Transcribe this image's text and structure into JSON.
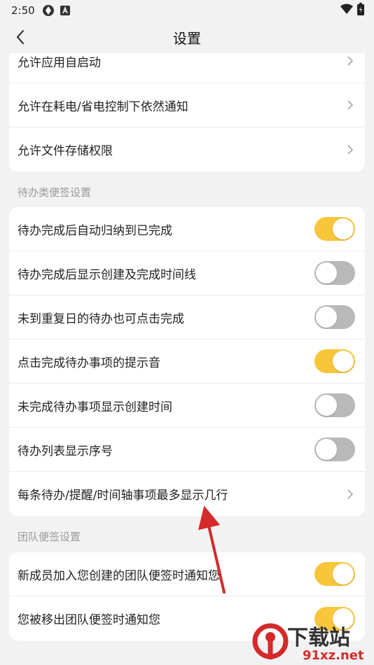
{
  "status_bar": {
    "time": "2:50"
  },
  "header": {
    "title": "设置"
  },
  "permissions": [
    {
      "label": "允许应用自启动"
    },
    {
      "label": "允许在耗电/省电控制下依然通知"
    },
    {
      "label": "允许文件存储权限"
    }
  ],
  "todo_section": {
    "title": "待办类便签设置",
    "items": [
      {
        "label": "待办完成后自动归纳到已完成",
        "type": "toggle",
        "on": true
      },
      {
        "label": "待办完成后显示创建及完成时间线",
        "type": "toggle",
        "on": false
      },
      {
        "label": "未到重复日的待办也可点击完成",
        "type": "toggle",
        "on": false
      },
      {
        "label": "点击完成待办事项的提示音",
        "type": "toggle",
        "on": true
      },
      {
        "label": "未完成待办事项显示创建时间",
        "type": "toggle",
        "on": false
      },
      {
        "label": "待办列表显示序号",
        "type": "toggle",
        "on": false
      },
      {
        "label": "每条待办/提醒/时间轴事项最多显示几行",
        "type": "link"
      }
    ]
  },
  "team_section": {
    "title": "团队便签设置",
    "items": [
      {
        "label": "新成员加入您创建的团队便签时通知您",
        "type": "toggle",
        "on": true
      },
      {
        "label": "您被移出团队便签时通知您",
        "type": "toggle",
        "on": true
      }
    ]
  },
  "watermark": {
    "title": "下载站",
    "url": "91xz.net"
  },
  "colors": {
    "toggle_on": "#f7c63b",
    "toggle_off": "#b9b9b9",
    "arrow": "#d42a2a"
  }
}
